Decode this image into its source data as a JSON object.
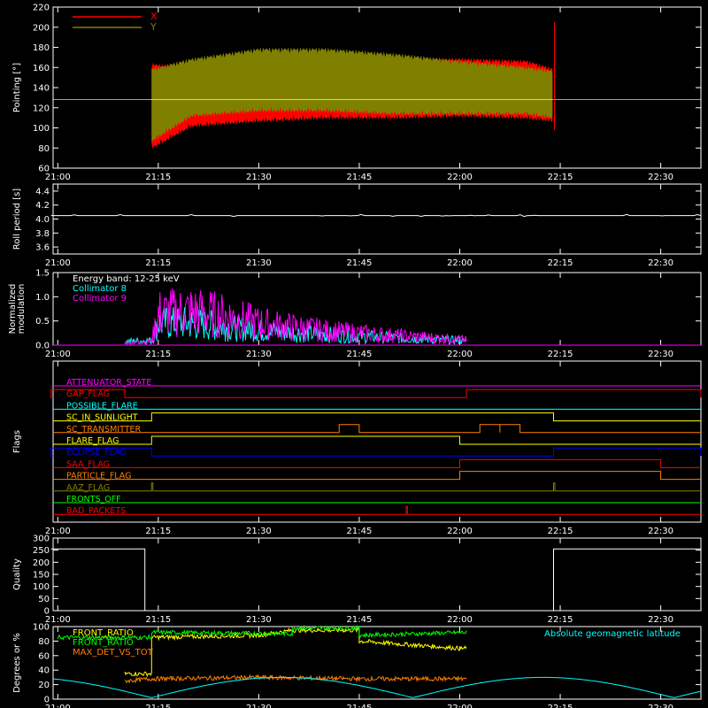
{
  "colors": {
    "x": "#ff0000",
    "y": "#808000",
    "white": "#ffffff",
    "cyan": "#00ffff",
    "magenta": "#ff00ff",
    "yellow": "#ffff00",
    "green": "#00ff00",
    "orange": "#ff8000",
    "blue": "#0000ff",
    "red": "#ff0000",
    "olive": "#808000",
    "ltgreen": "#00ff00"
  },
  "time_ticks": [
    "21:00",
    "21:15",
    "21:30",
    "21:45",
    "22:00",
    "22:15",
    "22:30"
  ],
  "chart_data": [
    {
      "type": "area",
      "id": "pointing",
      "ylabel": "Pointing [°]",
      "ylim": [
        60,
        220
      ],
      "yticks": [
        "60",
        "80",
        "100",
        "120",
        "140",
        "160",
        "180",
        "200",
        "220"
      ],
      "legend": [
        {
          "name": "X",
          "color": "#ff0000"
        },
        {
          "name": "Y",
          "color": "#808000"
        }
      ],
      "ref_line": 128,
      "series": [
        {
          "name": "X",
          "color": "#ff0000",
          "x": [
            "21:14",
            "21:20",
            "21:30",
            "21:40",
            "21:50",
            "22:00",
            "22:10",
            "22:14"
          ],
          "max": [
            165,
            160,
            172,
            175,
            168,
            170,
            168,
            160
          ],
          "min": [
            78,
            100,
            105,
            108,
            108,
            110,
            108,
            105
          ]
        },
        {
          "name": "Y",
          "color": "#808000",
          "x": [
            "21:14",
            "21:20",
            "21:30",
            "21:40",
            "21:50",
            "22:00",
            "22:10",
            "22:14"
          ],
          "max": [
            160,
            170,
            180,
            180,
            175,
            168,
            162,
            158
          ],
          "min": [
            85,
            110,
            115,
            115,
            112,
            112,
            112,
            108
          ]
        }
      ]
    },
    {
      "type": "line",
      "id": "roll",
      "ylabel": "Roll period [s]",
      "ylim": [
        3.5,
        4.5
      ],
      "yticks": [
        "3.6",
        "3.8",
        "4.0",
        "4.2",
        "4.4"
      ],
      "series": [
        {
          "name": "",
          "color": "#ffffff",
          "x": [
            "20:59",
            "22:36"
          ],
          "y": [
            4.05,
            4.05
          ]
        }
      ]
    },
    {
      "type": "line",
      "id": "modulation",
      "ylabel": "Normalized modulation",
      "ylim": [
        0,
        1.5
      ],
      "yticks": [
        "0.0",
        "0.5",
        "1.0",
        "1.5"
      ],
      "legend": [
        {
          "name": "Energy band: 12-25 keV",
          "color": "#ffffff"
        },
        {
          "name": "Collimator 8",
          "color": "#00ffff"
        },
        {
          "name": "Collimator 9",
          "color": "#ff00ff"
        }
      ],
      "series": [
        {
          "name": "Collimator 8",
          "color": "#00ffff",
          "x": [
            "21:10",
            "21:14",
            "21:15",
            "21:20",
            "21:25",
            "21:30",
            "21:40",
            "21:50",
            "22:00",
            "22:01"
          ],
          "y": [
            0.08,
            0.1,
            0.45,
            0.45,
            0.38,
            0.3,
            0.22,
            0.15,
            0.1,
            0.08
          ]
        },
        {
          "name": "Collimator 9",
          "color": "#ff00ff",
          "x": [
            "21:10",
            "21:14",
            "21:15",
            "21:20",
            "21:25",
            "21:30",
            "21:40",
            "21:50",
            "22:00",
            "22:01"
          ],
          "y": [
            0.05,
            0.08,
            0.65,
            0.7,
            0.6,
            0.45,
            0.3,
            0.2,
            0.12,
            0.1
          ]
        }
      ]
    },
    {
      "type": "line",
      "id": "flags",
      "ylabel": "Flags",
      "flags": [
        {
          "name": "ATTENUATOR_STATE",
          "color": "#ff00ff",
          "on": []
        },
        {
          "name": "GAP_FLAG",
          "color": "#ff0000",
          "on": [
            [
              "20:59",
              "21:10"
            ],
            [
              "22:01",
              "22:36"
            ]
          ]
        },
        {
          "name": "POSSIBLE_FLARE",
          "color": "#00ffff",
          "on": []
        },
        {
          "name": "SC_IN_SUNLIGHT",
          "color": "#ffff00",
          "on": [
            [
              "21:14",
              "22:14"
            ]
          ]
        },
        {
          "name": "SC_TRANSMITTER",
          "color": "#ff8000",
          "on": [
            [
              "21:42",
              "21:45"
            ],
            [
              "22:03",
              "22:06"
            ],
            [
              "22:06",
              "22:09"
            ]
          ]
        },
        {
          "name": "FLARE_FLAG",
          "color": "#ffff00",
          "on": [
            [
              "21:14",
              "22:00"
            ]
          ]
        },
        {
          "name": "ECLIPSE_FLAG",
          "color": "#0000ff",
          "on": [
            [
              "20:59",
              "21:14"
            ],
            [
              "22:14",
              "22:36"
            ]
          ]
        },
        {
          "name": "SAA_FLAG",
          "color": "#ff0000",
          "on": [
            [
              "22:00",
              "22:30"
            ]
          ]
        },
        {
          "name": "PARTICLE_FLAG",
          "color": "#ff8000",
          "on": [
            [
              "22:00",
              "22:30"
            ]
          ]
        },
        {
          "name": "AAZ_FLAG",
          "color": "#808000",
          "on": [
            [
              "21:14",
              "21:14"
            ],
            [
              "22:14",
              "22:14"
            ]
          ]
        },
        {
          "name": "FRONTS_OFF",
          "color": "#00ff00",
          "on": []
        },
        {
          "name": "BAD_PACKETS",
          "color": "#ff0000",
          "on": [
            [
              "21:52",
              "21:52"
            ]
          ]
        }
      ]
    },
    {
      "type": "line",
      "id": "quality",
      "ylabel": "Quality",
      "ylim": [
        0,
        300
      ],
      "yticks": [
        "0",
        "50",
        "100",
        "150",
        "200",
        "250",
        "300"
      ],
      "series": [
        {
          "name": "",
          "color": "#ffffff",
          "x": [
            "20:59",
            "21:13",
            "21:13",
            "22:14",
            "22:14",
            "22:36"
          ],
          "y": [
            255,
            255,
            0,
            0,
            255,
            255
          ]
        }
      ]
    },
    {
      "type": "line",
      "id": "ratios",
      "ylabel": "Degrees or %",
      "ylim": [
        0,
        100
      ],
      "yticks": [
        "0",
        "20",
        "40",
        "60",
        "80",
        "100"
      ],
      "legend": [
        {
          "name": "FRONT_RATIO",
          "color": "#ffff00"
        },
        {
          "name": "FRONT_RATIO",
          "color": "#00ff00"
        },
        {
          "name": "MAX_DET_VS_TOT",
          "color": "#ff8000"
        },
        {
          "name": "Absolute geomagnetic latitude",
          "color": "#00ffff"
        }
      ],
      "series": [
        {
          "name": "FRONT_RATIO",
          "color": "#ffff00",
          "x": [
            "21:10",
            "21:14",
            "21:14",
            "21:30",
            "21:35",
            "21:45",
            "21:45",
            "22:00",
            "22:01"
          ],
          "y": [
            35,
            35,
            85,
            88,
            95,
            95,
            80,
            70,
            70
          ]
        },
        {
          "name": "FRONT_RATIO",
          "color": "#00ff00",
          "x": [
            "21:00",
            "21:14",
            "21:14",
            "21:35",
            "21:35",
            "21:45",
            "21:45",
            "22:01"
          ],
          "y": [
            85,
            85,
            92,
            90,
            98,
            98,
            88,
            92
          ]
        },
        {
          "name": "MAX_DET_VS_TOT",
          "color": "#ff8000",
          "x": [
            "21:10",
            "21:14",
            "21:30",
            "21:45",
            "22:01"
          ],
          "y": [
            25,
            28,
            30,
            28,
            28
          ]
        },
        {
          "name": "Absolute geomagnetic latitude",
          "color": "#00ffff",
          "x": [
            "20:59",
            "21:07",
            "21:15",
            "21:25",
            "21:35",
            "21:45",
            "21:53",
            "22:01",
            "22:10",
            "22:25",
            "22:36"
          ],
          "y": [
            28,
            15,
            2,
            15,
            28,
            20,
            2,
            15,
            28,
            30,
            20
          ]
        }
      ]
    }
  ]
}
